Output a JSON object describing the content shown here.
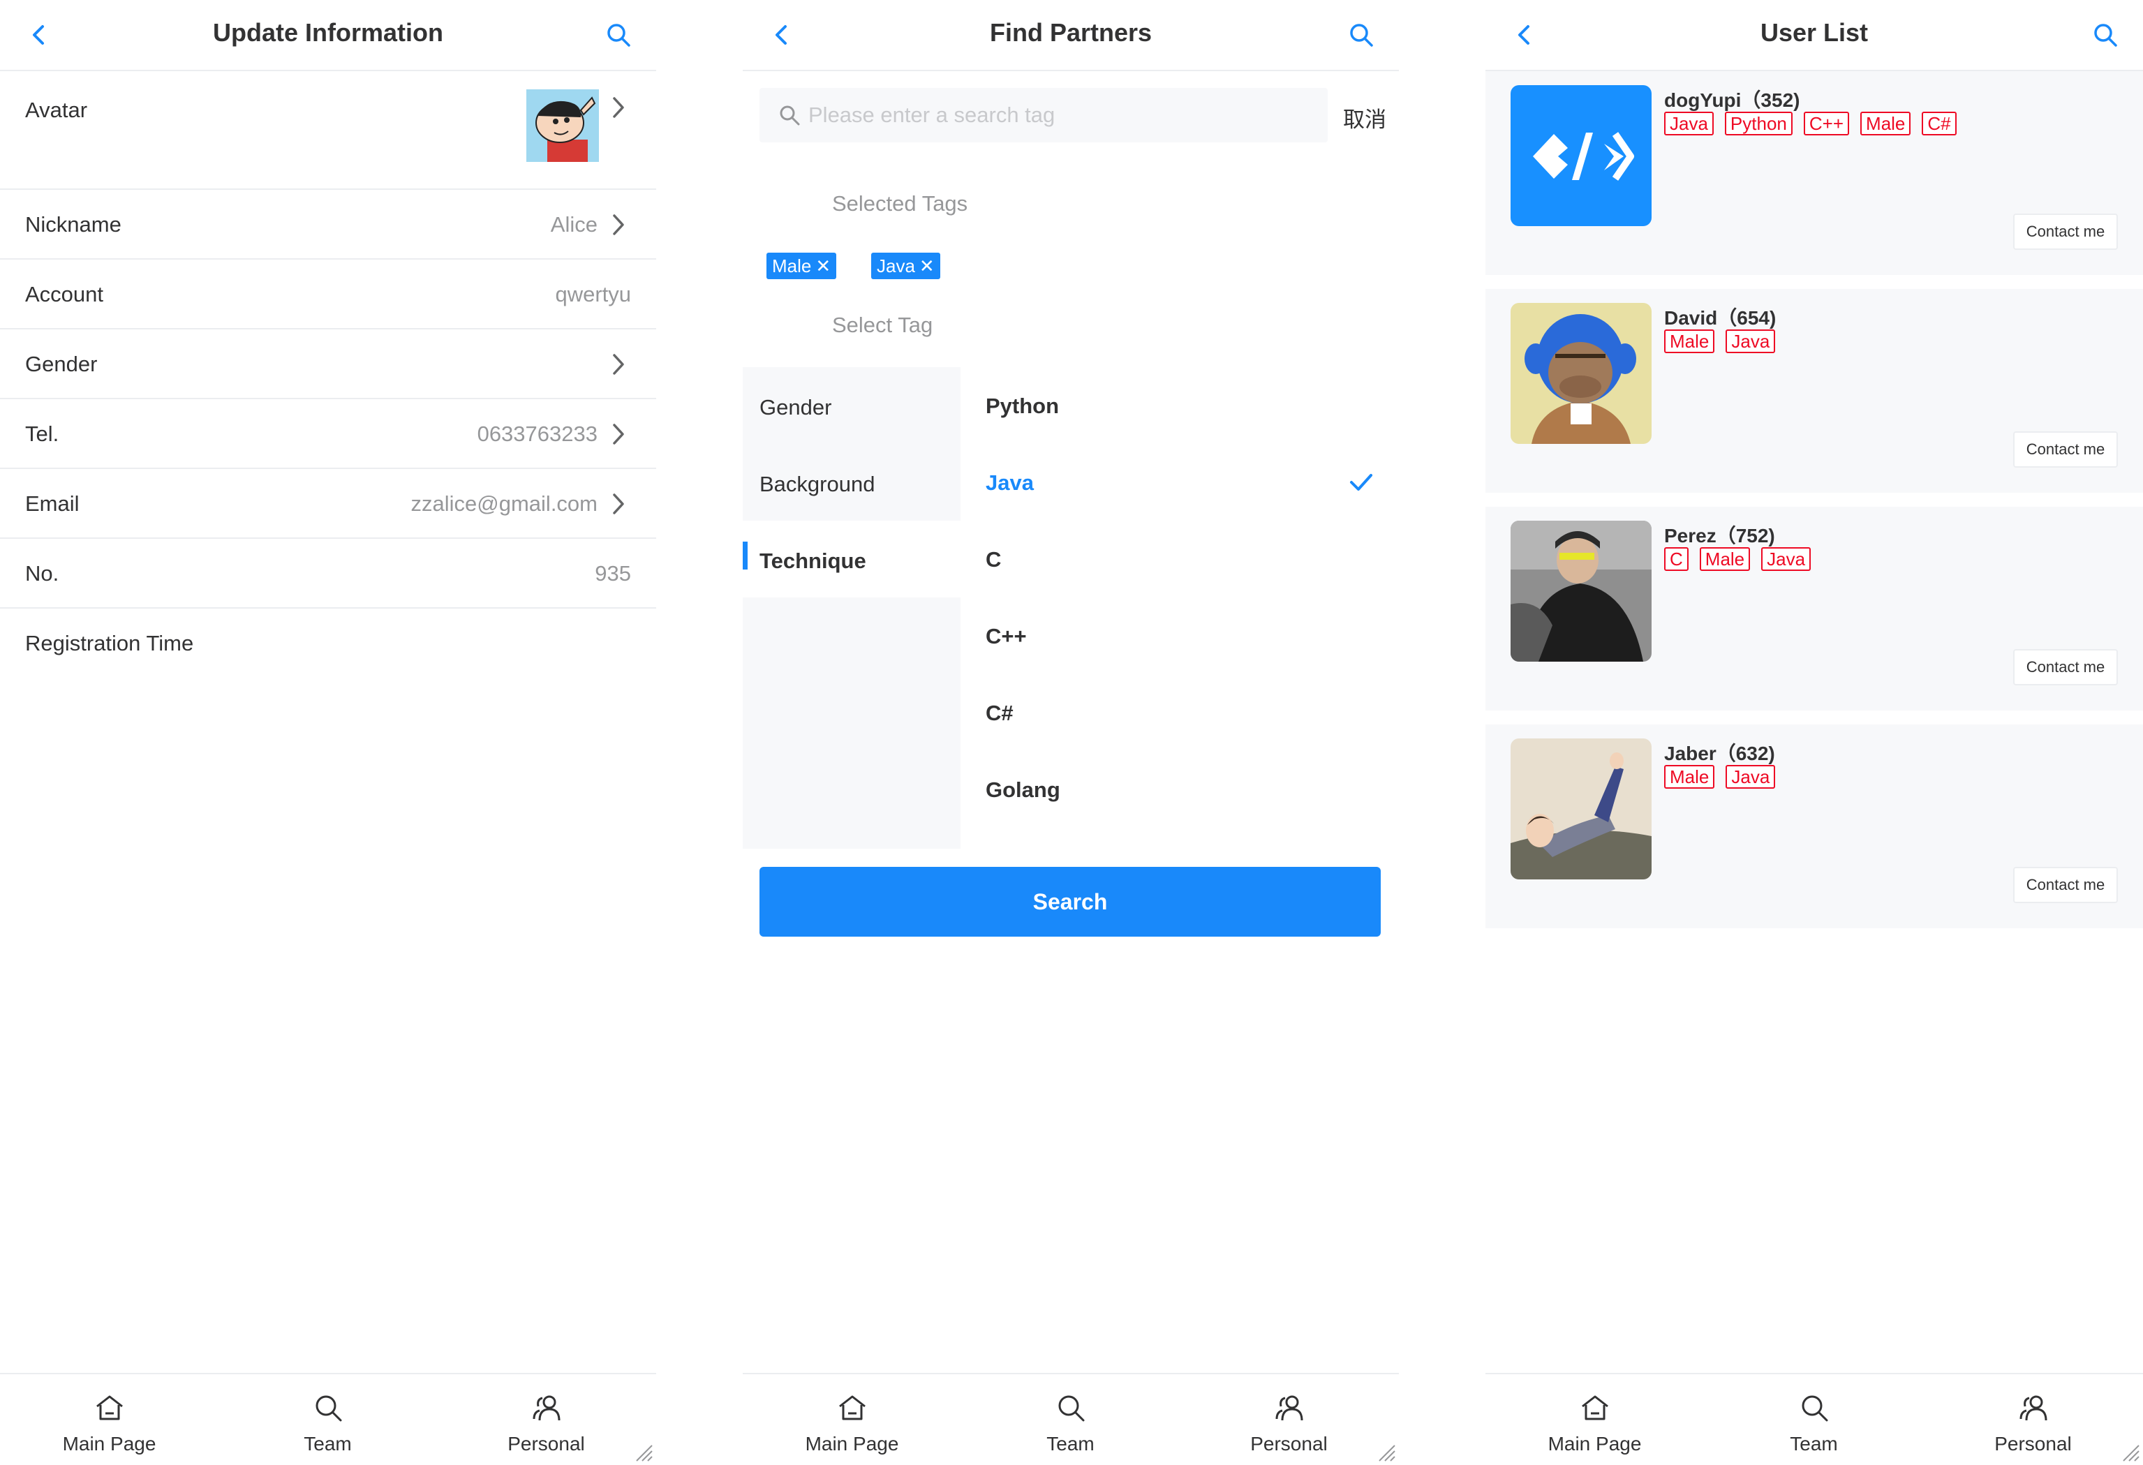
{
  "panel_update": {
    "title": "Update Information",
    "rows": [
      {
        "label": "Avatar",
        "value": ""
      },
      {
        "label": "Nickname",
        "value": "Alice"
      },
      {
        "label": "Account",
        "value": "qwertyu"
      },
      {
        "label": "Gender",
        "value": ""
      },
      {
        "label": "Tel.",
        "value": "0633763233"
      },
      {
        "label": "Email",
        "value": "zzalice@gmail.com"
      },
      {
        "label": "No.",
        "value": "935"
      },
      {
        "label": "Registration Time",
        "value": ""
      }
    ]
  },
  "panel_find": {
    "title": "Find Partners",
    "search": {
      "placeholder": "Please enter a search tag",
      "value": ""
    },
    "cancel_label": "取消",
    "selected_title": "Selected Tags",
    "selected_tags": [
      "Male",
      "Java"
    ],
    "select_title": "Select Tag",
    "categories": [
      {
        "label": "Gender",
        "active": false
      },
      {
        "label": "Background",
        "active": false
      },
      {
        "label": "Technique",
        "active": true
      }
    ],
    "options": [
      {
        "label": "Python",
        "selected": false
      },
      {
        "label": "Java",
        "selected": true
      },
      {
        "label": "C",
        "selected": false
      },
      {
        "label": "C++",
        "selected": false
      },
      {
        "label": "C#",
        "selected": false
      },
      {
        "label": "Golang",
        "selected": false
      }
    ],
    "search_button_label": "Search"
  },
  "panel_users": {
    "title": "User List",
    "users": [
      {
        "title": "dogYupi（352)",
        "tags": [
          "Java",
          "Python",
          "C++",
          "Male",
          "C#"
        ],
        "contact_label": "Contact me"
      },
      {
        "title": "David（654)",
        "tags": [
          "Male",
          "Java"
        ],
        "contact_label": "Contact me"
      },
      {
        "title": "Perez（752)",
        "tags": [
          "C",
          "Male",
          "Java"
        ],
        "contact_label": "Contact me"
      },
      {
        "title": "Jaber（632)",
        "tags": [
          "Male",
          "Java"
        ],
        "contact_label": "Contact me"
      }
    ]
  },
  "tabbar": {
    "tabs": [
      {
        "label": "Main Page",
        "icon": "home-icon"
      },
      {
        "label": "Team",
        "icon": "search-icon"
      },
      {
        "label": "Personal",
        "icon": "friends-icon"
      }
    ]
  },
  "colors": {
    "accent": "#1989fa",
    "tag_red": "#ee0a24",
    "divider": "#ebedf0",
    "muted_text": "#969799",
    "bg_gray": "#f7f8fa"
  }
}
